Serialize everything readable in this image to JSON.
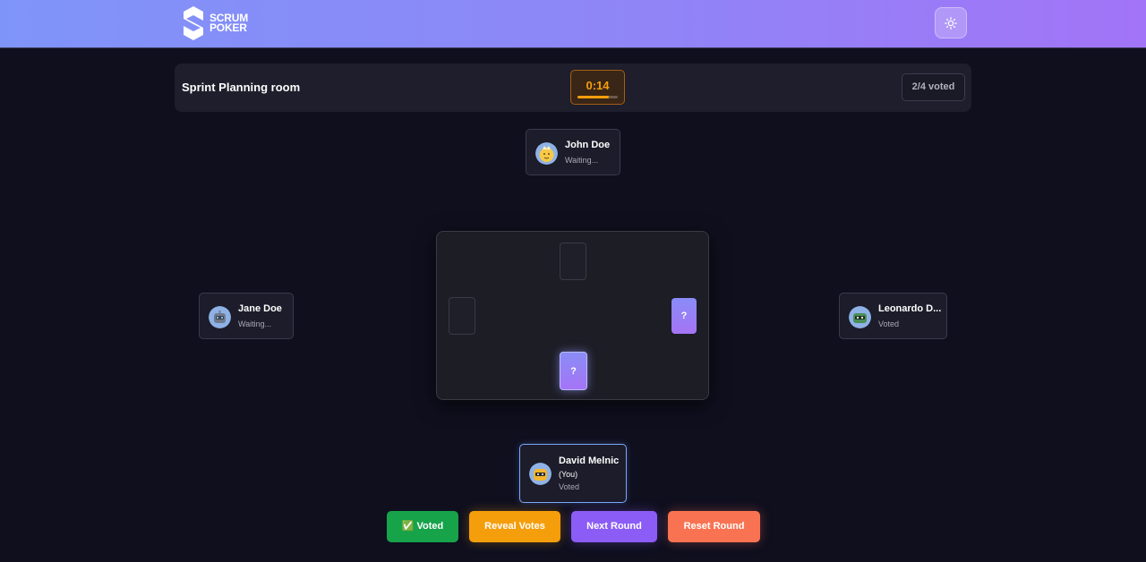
{
  "header": {
    "logo_line1": "SCRUM",
    "logo_line2": "POKER",
    "theme_icon": "sun-icon"
  },
  "room": {
    "title": "Sprint Planning room",
    "timer": "0:14",
    "timer_progress": 0.78,
    "voted_status": "2/4 voted"
  },
  "players": [
    {
      "name": "John Doe",
      "status": "Waiting...",
      "avatar": "emoji-face-avatar"
    },
    {
      "name": "Jane Doe",
      "status": "Waiting...",
      "avatar": "robot-avatar"
    },
    {
      "name": "Leonardo D...",
      "status": "Voted",
      "avatar": "robot-avatar"
    },
    {
      "name": "David Melnic",
      "sub": "(You)",
      "status": "Voted",
      "avatar": "robot-avatar"
    }
  ],
  "table": {
    "hidden_card_label": "?"
  },
  "actions": {
    "voted": "✅ Voted",
    "reveal": "Reveal Votes",
    "next": "Next Round",
    "reset": "Reset Round"
  },
  "colors": {
    "voted": "#16a34a",
    "reveal": "#f59e0b",
    "next": "#8b5cf6",
    "reset": "#f97352",
    "accent": "#7aa7ff"
  }
}
